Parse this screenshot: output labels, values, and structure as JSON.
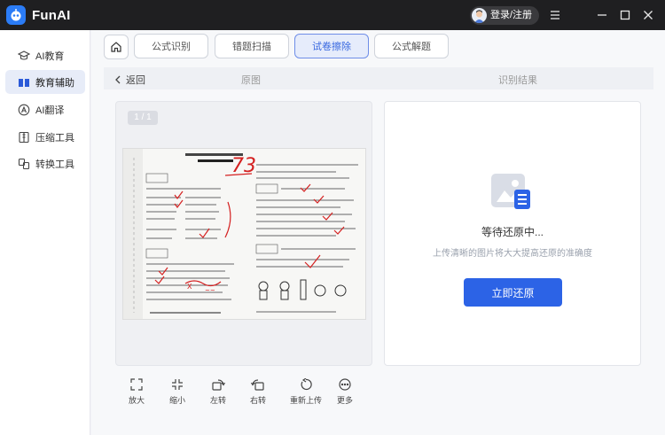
{
  "app": {
    "title": "FunAI"
  },
  "titlebar": {
    "login_label": "登录/注册"
  },
  "sidebar": {
    "items": [
      {
        "label": "AI教育",
        "icon": "graduation-cap-icon"
      },
      {
        "label": "教育辅助",
        "icon": "book-icon"
      },
      {
        "label": "AI翻译",
        "icon": "translate-icon"
      },
      {
        "label": "压缩工具",
        "icon": "compress-icon"
      },
      {
        "label": "转换工具",
        "icon": "convert-icon"
      }
    ],
    "active_index": 1
  },
  "tabs": [
    {
      "label": "公式识别"
    },
    {
      "label": "错题扫描"
    },
    {
      "label": "试卷擦除"
    },
    {
      "label": "公式解题"
    }
  ],
  "subheader": {
    "back_label": "返回",
    "original_label": "原图",
    "result_label": "识别结果"
  },
  "left_panel": {
    "page_indicator": "1 / 1"
  },
  "right_panel": {
    "title": "等待还原中...",
    "description": "上传清晰的图片将大大提高还原的准确度",
    "button_label": "立即还原"
  },
  "toolbar": [
    {
      "label": "放大",
      "icon": "zoom-in-icon"
    },
    {
      "label": "缩小",
      "icon": "zoom-out-icon"
    },
    {
      "label": "左转",
      "icon": "rotate-left-icon"
    },
    {
      "label": "右转",
      "icon": "rotate-right-icon"
    },
    {
      "label": "重新上传",
      "icon": "reupload-icon"
    },
    {
      "label": "更多",
      "icon": "more-icon"
    }
  ],
  "colors": {
    "accent": "#2c63e6",
    "titlebar": "#1f1f21",
    "grade_red": "#d42020"
  }
}
